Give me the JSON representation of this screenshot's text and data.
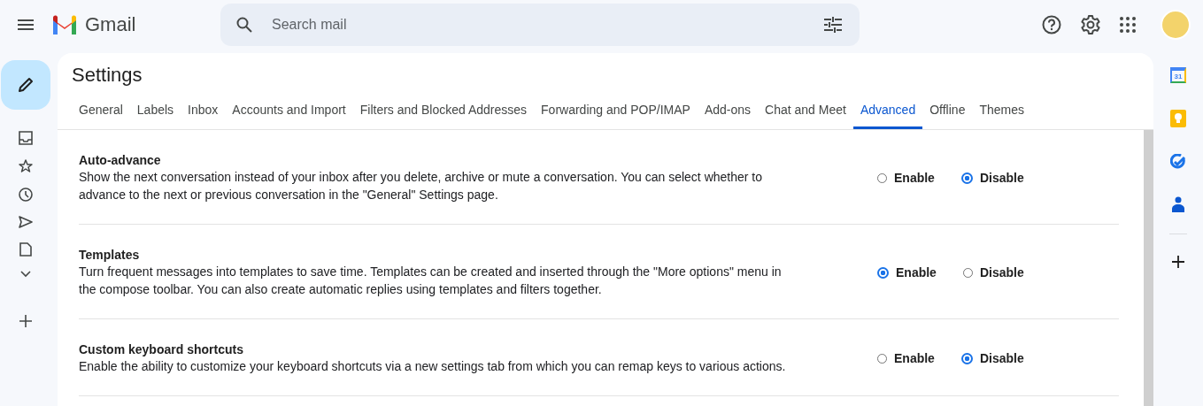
{
  "app": {
    "name": "Gmail"
  },
  "search": {
    "placeholder": "Search mail"
  },
  "page": {
    "title": "Settings"
  },
  "tabs": [
    {
      "label": "General",
      "selected": false
    },
    {
      "label": "Labels",
      "selected": false
    },
    {
      "label": "Inbox",
      "selected": false
    },
    {
      "label": "Accounts and Import",
      "selected": false
    },
    {
      "label": "Filters and Blocked Addresses",
      "selected": false
    },
    {
      "label": "Forwarding and POP/IMAP",
      "selected": false
    },
    {
      "label": "Add-ons",
      "selected": false
    },
    {
      "label": "Chat and Meet",
      "selected": false
    },
    {
      "label": "Advanced",
      "selected": true
    },
    {
      "label": "Offline",
      "selected": false
    },
    {
      "label": "Themes",
      "selected": false
    }
  ],
  "settings": [
    {
      "title": "Auto-advance",
      "description": "Show the next conversation instead of your inbox after you delete, archive or mute a conversation. You can select whether to advance to the next or previous conversation in the \"General\" Settings page.",
      "options": [
        {
          "label": "Enable",
          "selected": false
        },
        {
          "label": "Disable",
          "selected": true
        }
      ]
    },
    {
      "title": "Templates",
      "description": "Turn frequent messages into templates to save time. Templates can be created and inserted through the \"More options\" menu in the compose toolbar. You can also create automatic replies using templates and filters together.",
      "options": [
        {
          "label": "Enable",
          "selected": true
        },
        {
          "label": "Disable",
          "selected": false
        }
      ]
    },
    {
      "title": "Custom keyboard shortcuts",
      "description": "Enable the ability to customize your keyboard shortcuts via a new settings tab from which you can remap keys to various actions.",
      "options": [
        {
          "label": "Enable",
          "selected": false
        },
        {
          "label": "Disable",
          "selected": true
        }
      ]
    }
  ],
  "side_panel": {
    "calendar_day": "31"
  }
}
